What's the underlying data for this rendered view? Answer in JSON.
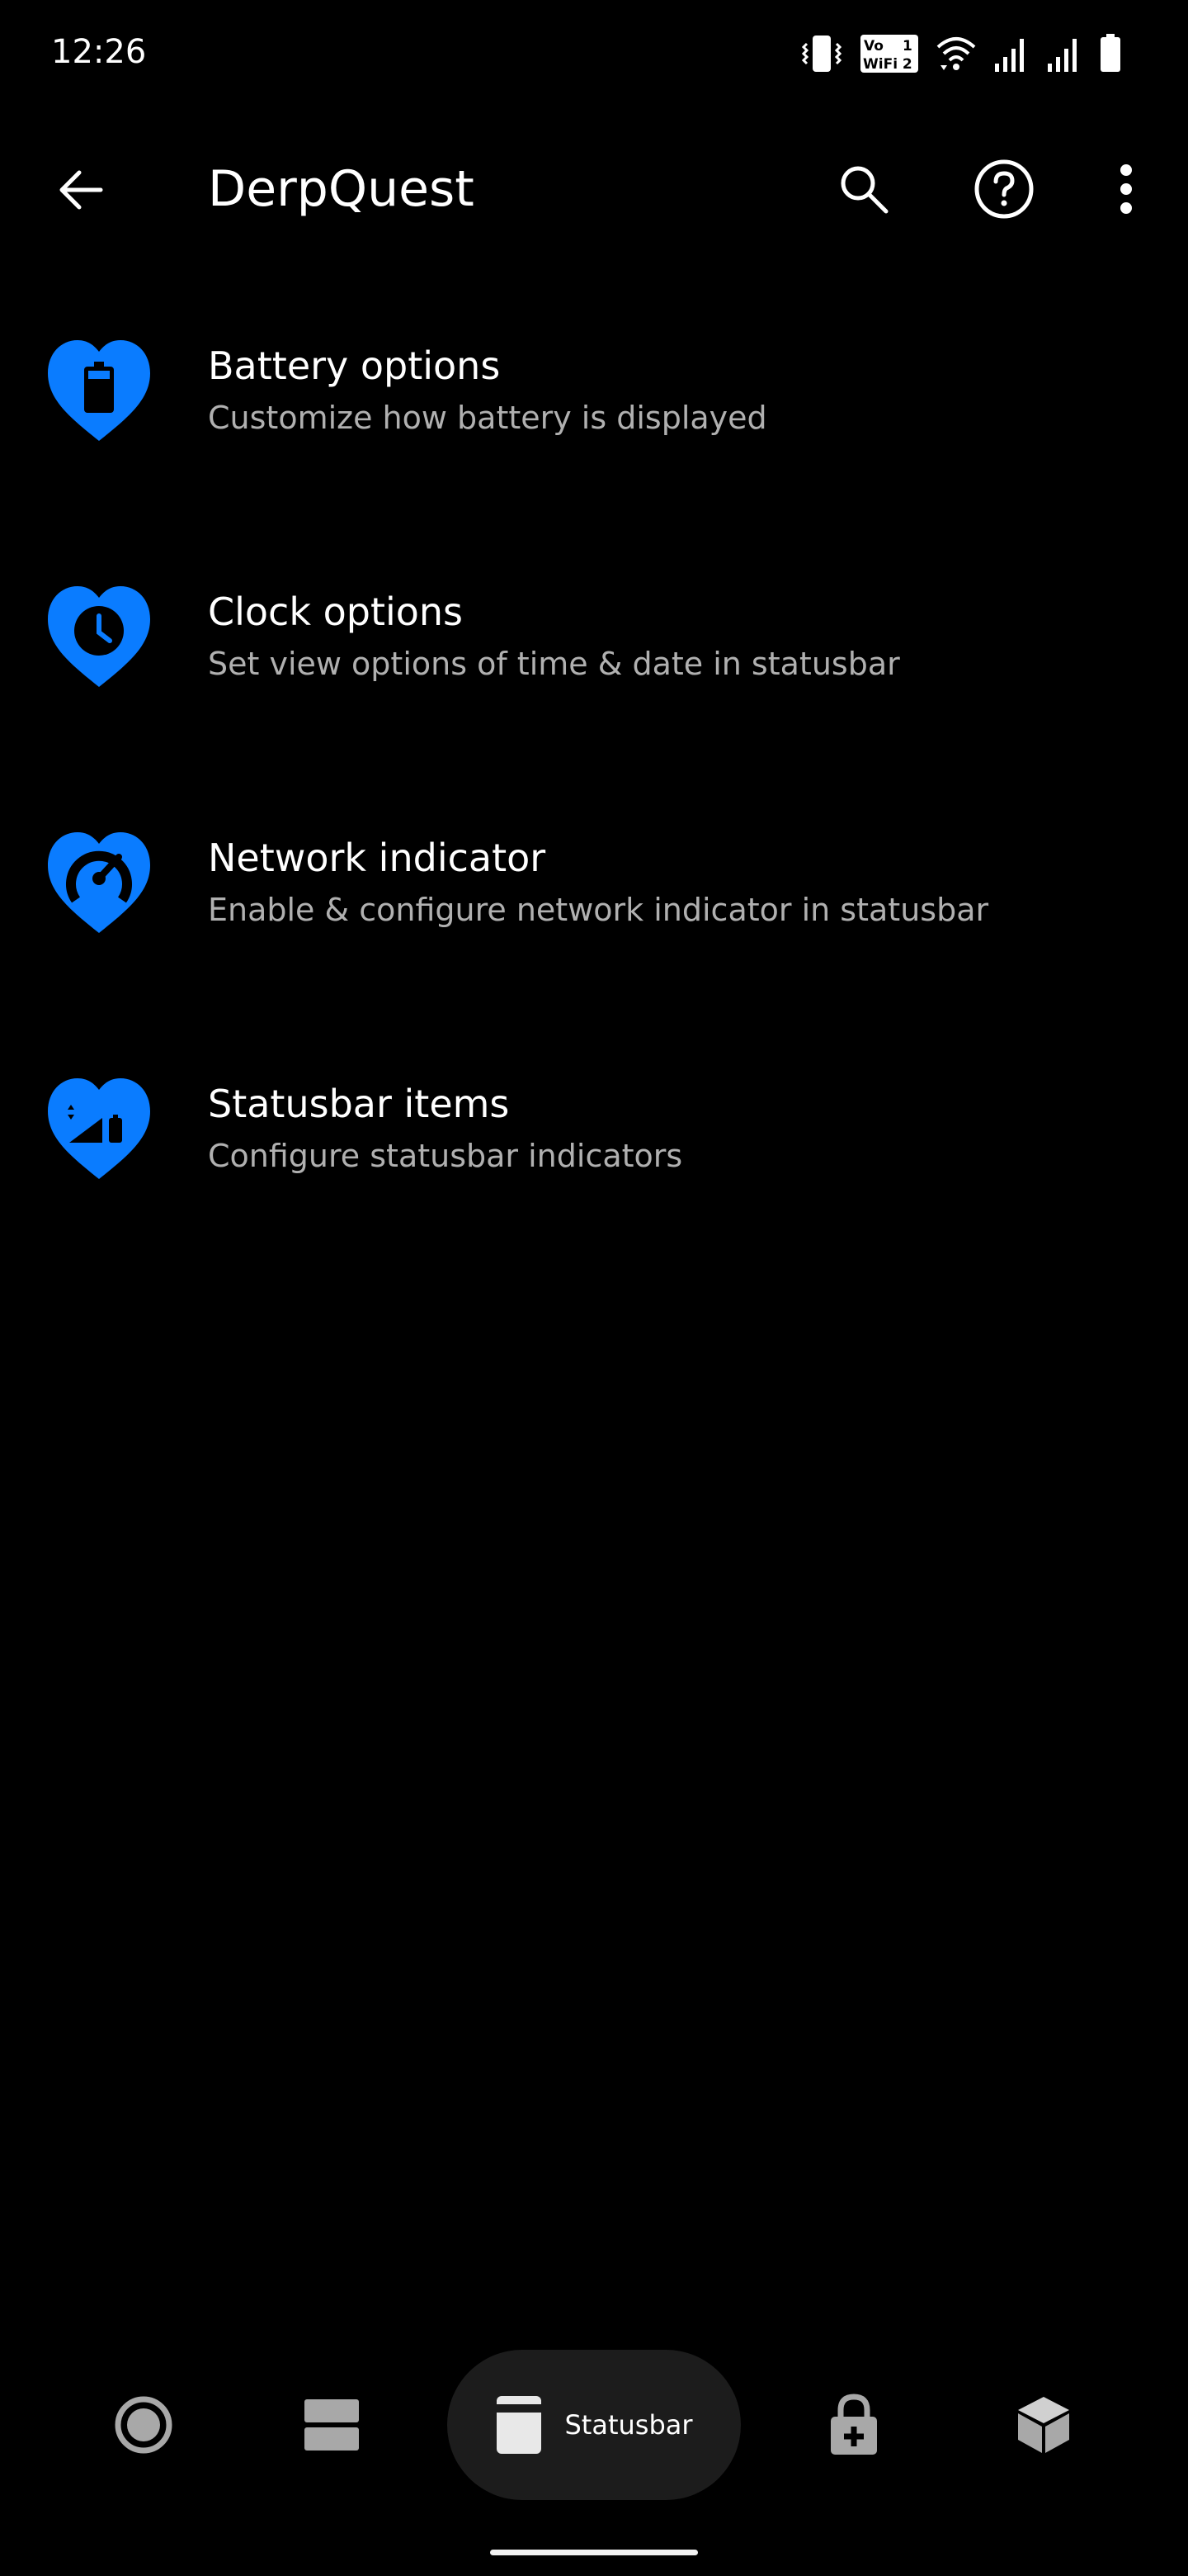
{
  "status_bar": {
    "time": "12:26",
    "volte_line1": "Vo",
    "volte_line2": "WiFi 2",
    "volte_badge": "1",
    "icons": [
      "vibrate-icon",
      "vowifi-icon",
      "wifi-icon",
      "signal-icon",
      "signal-icon",
      "battery-icon"
    ]
  },
  "app_bar": {
    "title": "DerpQuest",
    "icons": [
      "back-arrow-icon",
      "search-icon",
      "help-icon",
      "more-vert-icon"
    ]
  },
  "items": [
    {
      "title": "Battery options",
      "subtitle": "Customize how battery is displayed",
      "icon": "battery-heart-icon"
    },
    {
      "title": "Clock options",
      "subtitle": "Set view options of time & date in statusbar",
      "icon": "clock-heart-icon"
    },
    {
      "title": "Network indicator",
      "subtitle": "Enable & configure network indicator in statusbar",
      "icon": "speedometer-heart-icon"
    },
    {
      "title": "Statusbar items",
      "subtitle": "Configure statusbar indicators",
      "icon": "statusbar-heart-icon"
    }
  ],
  "bottom_nav": {
    "active_label": "Statusbar",
    "items": [
      "radio-icon",
      "split-view-icon",
      "statusbar-icon",
      "lock-add-icon",
      "cube-icon"
    ]
  },
  "colors": {
    "accent": "#0a7cff",
    "background": "#000000",
    "subtitle": "#b0b0b0",
    "nav_pill": "#1c1c1c"
  }
}
